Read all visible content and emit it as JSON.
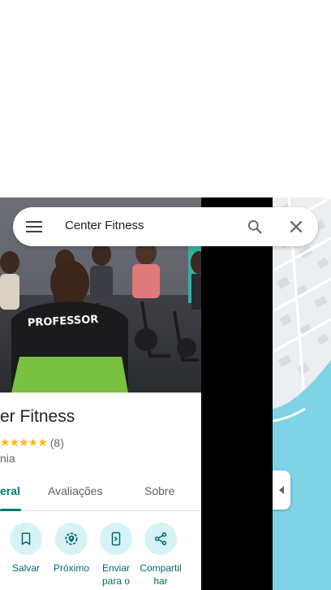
{
  "search": {
    "query": "Center Fitness"
  },
  "place": {
    "title": "er Fitness",
    "stars": "★★★★★",
    "review_count": "(8)",
    "category": "nia"
  },
  "tabs": [
    {
      "label": "eral"
    },
    {
      "label": "Avaliações"
    },
    {
      "label": "Sobre"
    }
  ],
  "actions": [
    {
      "label": "Salvar",
      "icon": "bookmark-icon"
    },
    {
      "label": "Próximo",
      "icon": "nearby-icon"
    },
    {
      "label": "Enviar para o",
      "icon": "send-to-phone-icon"
    },
    {
      "label": "Compartilhar",
      "icon": "share-icon"
    }
  ],
  "colors": {
    "accent": "#00796b",
    "action_bg": "#d7f3f8",
    "star": "#fbbc04",
    "water": "#7fd3e6"
  }
}
